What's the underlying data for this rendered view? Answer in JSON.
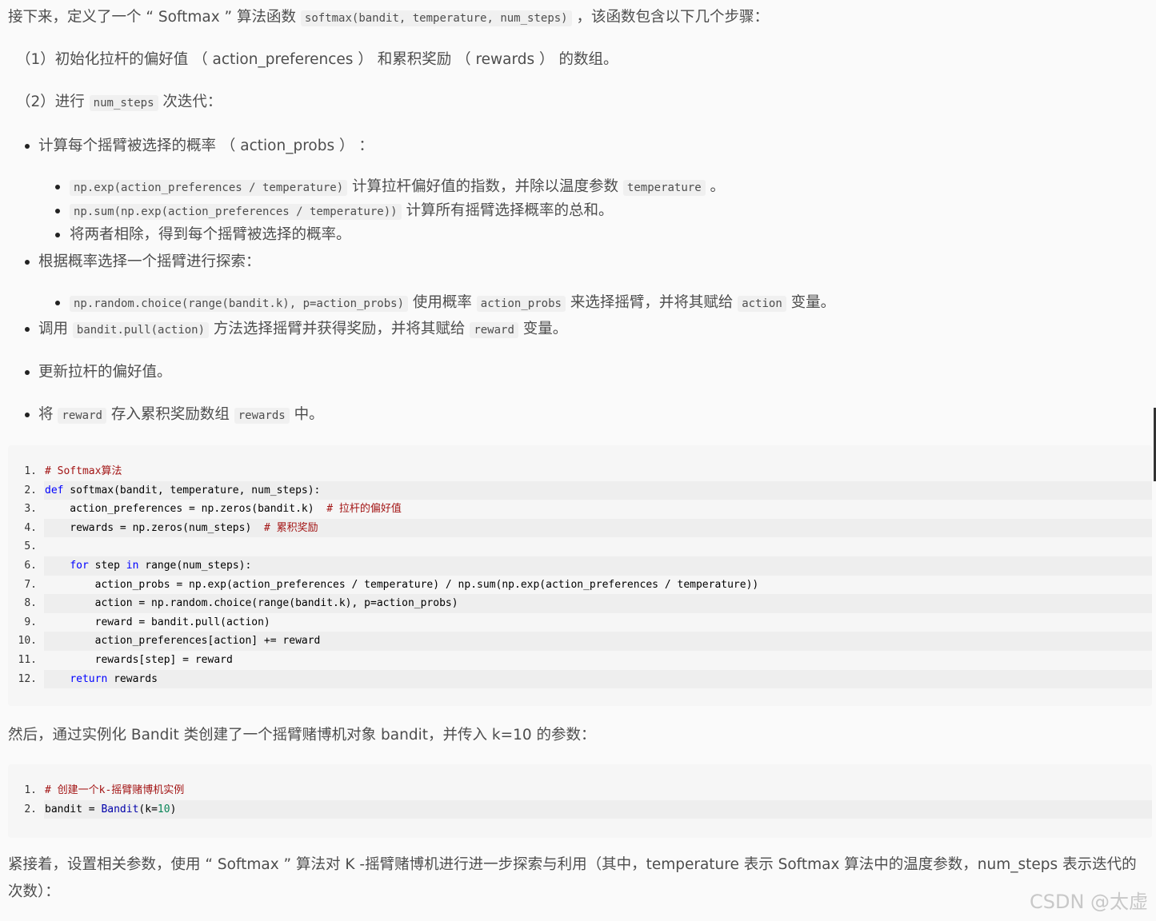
{
  "intro": {
    "prefix": "接下来，定义了一个 “ Softmax ” 算法函数 ",
    "code": "softmax(bandit, temperature, num_steps)",
    "suffix": " ，该函数包含以下几个步骤："
  },
  "steps": {
    "s1": "（1）初始化拉杆的偏好值 （ action_preferences ） 和累积奖励 （ rewards ） 的数组。",
    "s2_prefix": "（2）进行 ",
    "s2_code": "num_steps",
    "s2_suffix": " 次迭代："
  },
  "bullets": {
    "calc": "计算每个摇臂被选择的概率 （ action_probs ） ：",
    "calc_sub1_code": "np.exp(action_preferences / temperature)",
    "calc_sub1_text": " 计算拉杆偏好值的指数，并除以温度参数 ",
    "calc_sub1_code2": "temperature",
    "calc_sub1_end": " 。",
    "calc_sub2_code": "np.sum(np.exp(action_preferences / temperature))",
    "calc_sub2_text": " 计算所有摇臂选择概率的总和。",
    "calc_sub3": "将两者相除，得到每个摇臂被选择的概率。",
    "choose": "根据概率选择一个摇臂进行探索：",
    "choose_sub_code": "np.random.choice(range(bandit.k), p=action_probs)",
    "choose_sub_text1": " 使用概率 ",
    "choose_sub_code2": "action_probs",
    "choose_sub_text2": " 来选择摇臂，并将其赋给 ",
    "choose_sub_code3": "action",
    "choose_sub_text3": " 变量。",
    "pull_prefix": "调用 ",
    "pull_code": "bandit.pull(action)",
    "pull_text": " 方法选择摇臂并获得奖励，并将其赋给 ",
    "pull_code2": "reward",
    "pull_end": " 变量。",
    "update": "更新拉杆的偏好值。",
    "store_prefix": "将 ",
    "store_code": "reward",
    "store_text": " 存入累积奖励数组 ",
    "store_code2": "rewards",
    "store_end": " 中。"
  },
  "code1": {
    "line_numbers": [
      "1.",
      "2.",
      "3.",
      "4.",
      "5.",
      "6.",
      "7.",
      "8.",
      "9.",
      "10.",
      "11.",
      "12."
    ],
    "l1_cm": "# Softmax算法",
    "l2_kw": "def",
    "l2_rest": " softmax(bandit, temperature, num_steps):",
    "l3": "    action_preferences = np.zeros(bandit.k)  ",
    "l3_cm": "# 拉杆的偏好值",
    "l4": "    rewards = np.zeros(num_steps)  ",
    "l4_cm": "# 累积奖励",
    "l6_indent": "    ",
    "l6_kw1": "for",
    "l6_mid": " step ",
    "l6_kw2": "in",
    "l6_rest": " range(num_steps):",
    "l7": "        action_probs = np.exp(action_preferences / temperature) / np.sum(np.exp(action_preferences / temperature))",
    "l8": "        action = np.random.choice(range(bandit.k), p=action_probs)",
    "l9": "        reward = bandit.pull(action)",
    "l10": "        action_preferences[action] += reward",
    "l11": "        rewards[step] = reward",
    "l12_indent": "    ",
    "l12_kw": "return",
    "l12_rest": " rewards"
  },
  "para2": "然后，通过实例化 Bandit 类创建了一个摇臂赌博机对象 bandit，并传入 k=10 的参数：",
  "code2": {
    "line_numbers": [
      "1.",
      "2."
    ],
    "l1_cm": "# 创建一个k-摇臂赌博机实例",
    "l2_a": "bandit = ",
    "l2_fn": "Bandit",
    "l2_b": "(k=",
    "l2_num": "10",
    "l2_c": ")"
  },
  "para3": "紧接着，设置相关参数，使用 “ Softmax ” 算法对 K -摇臂赌博机进行进一步探索与利用（其中，temperature 表示 Softmax 算法中的温度参数，num_steps 表示迭代的次数）：",
  "watermark": "CSDN @太虚"
}
